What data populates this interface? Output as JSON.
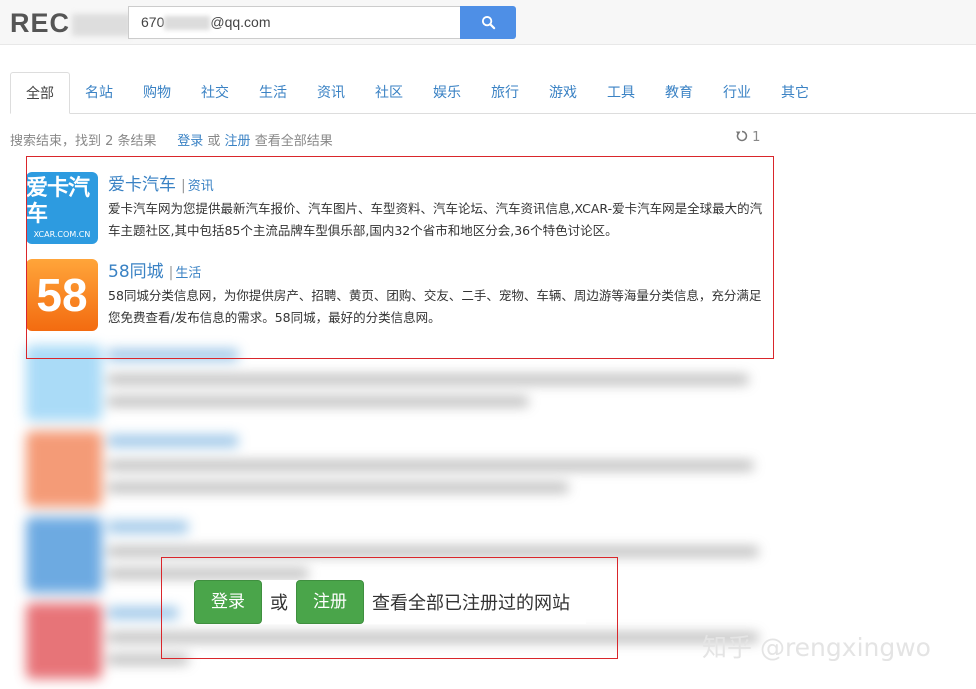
{
  "header": {
    "logo_text": "REC",
    "search_value_prefix": "670",
    "search_value_suffix": "@qq.com"
  },
  "tabs": [
    {
      "label": "全部",
      "active": true
    },
    {
      "label": "名站"
    },
    {
      "label": "购物"
    },
    {
      "label": "社交"
    },
    {
      "label": "生活"
    },
    {
      "label": "资讯"
    },
    {
      "label": "社区"
    },
    {
      "label": "娱乐"
    },
    {
      "label": "旅行"
    },
    {
      "label": "游戏"
    },
    {
      "label": "工具"
    },
    {
      "label": "教育"
    },
    {
      "label": "行业"
    },
    {
      "label": "其它"
    }
  ],
  "status": {
    "summary": "搜索结束，找到 2 条结果",
    "login": "登录",
    "or": "或",
    "register": "注册",
    "suffix": "查看全部结果",
    "refresh_count": "1"
  },
  "results": [
    {
      "title": "爱卡汽车",
      "category": "资讯",
      "icon_main": "爱卡汽车",
      "icon_sub": "XCAR.COM.CN",
      "description": "爱卡汽车网为您提供最新汽车报价、汽车图片、车型资料、汽车论坛、汽车资讯信息,XCAR-爱卡汽车网是全球最大的汽车主题社区,其中包括85个主流品牌车型俱乐部,国内32个省市和地区分会,36个特色讨论区。"
    },
    {
      "title": "58同城",
      "category": "生活",
      "icon_main": "58",
      "description": "58同城分类信息网，为你提供房产、招聘、黄页、团购、交友、二手、宠物、车辆、周边游等海量分类信息，充分满足您免费查看/发布信息的需求。58同城，最好的分类信息网。"
    }
  ],
  "overlay": {
    "login": "登录",
    "or": "或",
    "register": "注册",
    "text": "查看全部已注册过的网站"
  },
  "watermark": "知乎 @rengxingwo",
  "colors": {
    "accent": "#3a82c4",
    "search_button": "#4e8fe6",
    "green_button": "#4aa54a",
    "highlight_red": "#d9262b"
  }
}
